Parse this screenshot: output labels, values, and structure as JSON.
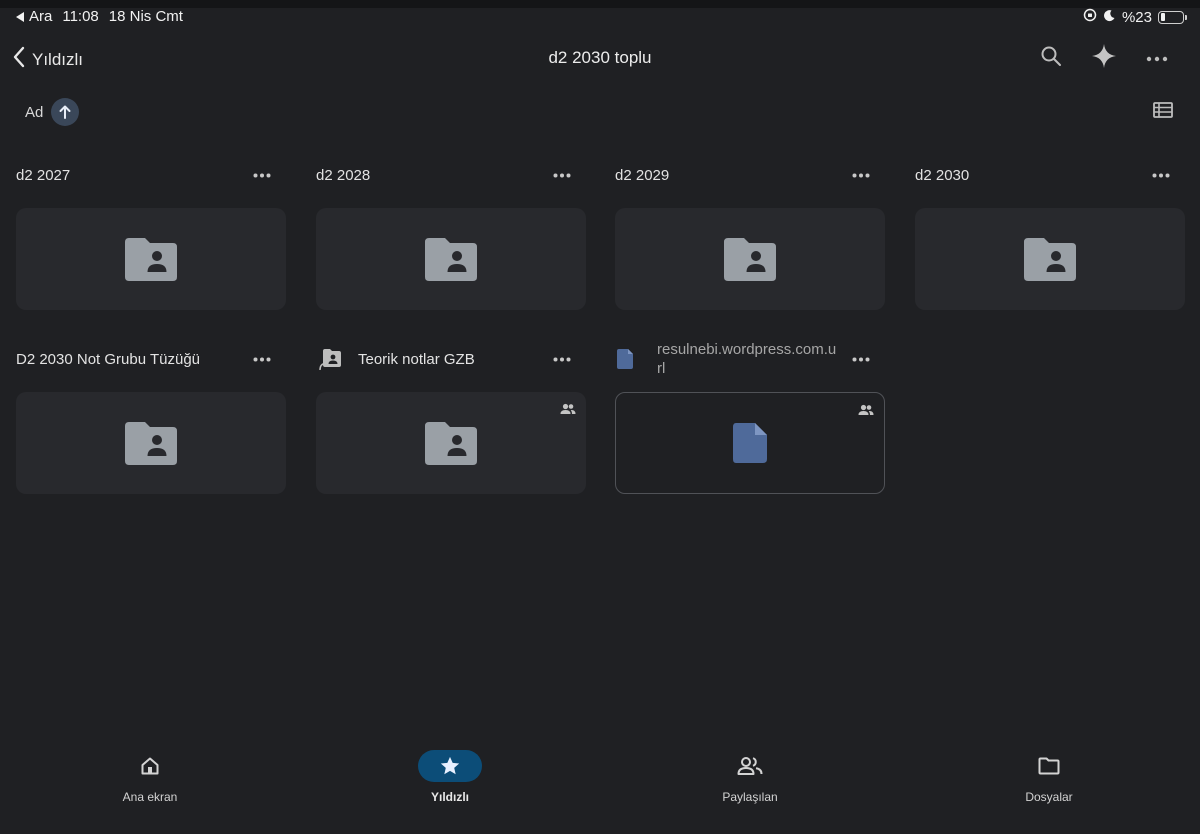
{
  "status_bar": {
    "back_app": "Ara",
    "time": "11:08",
    "date": "18 Nis Cmt",
    "battery": "%23",
    "battery_level": 0.23
  },
  "header": {
    "back_label": "Yıldızlı",
    "title": "d2 2030 toplu",
    "icons": [
      "search-icon",
      "sparkle-icon",
      "more-horizontal-icon"
    ]
  },
  "sort": {
    "label": "Ad",
    "direction_icon": "arrow-up-icon"
  },
  "view_toggle_icon": "list-view-icon",
  "items": [
    {
      "name": "d2 2027",
      "type": "shared-folder"
    },
    {
      "name": "d2 2028",
      "type": "shared-folder"
    },
    {
      "name": "d2 2029",
      "type": "shared-folder"
    },
    {
      "name": "d2 2030",
      "type": "shared-folder"
    },
    {
      "name": "D2 2030 Not Grubu Tüzüğü",
      "type": "shared-folder"
    },
    {
      "name": "Teorik notlar GZB",
      "type": "shortcut-shared-folder",
      "shared": true
    },
    {
      "name": "resulnebi.wordpress.com.url",
      "type": "file",
      "shared": true
    }
  ],
  "bottom_nav": [
    {
      "label": "Ana ekran",
      "icon": "home-icon",
      "active": false
    },
    {
      "label": "Yıldızlı",
      "icon": "star-icon",
      "active": true
    },
    {
      "label": "Paylaşılan",
      "icon": "people-icon",
      "active": false
    },
    {
      "label": "Dosyalar",
      "icon": "folder-icon",
      "active": false
    }
  ],
  "colors": {
    "background": "#1f2023",
    "card": "#28292d",
    "folder_icon": "#9aa0a6",
    "file_icon": "#4f6a9a",
    "active_nav": "#0c4d78"
  }
}
